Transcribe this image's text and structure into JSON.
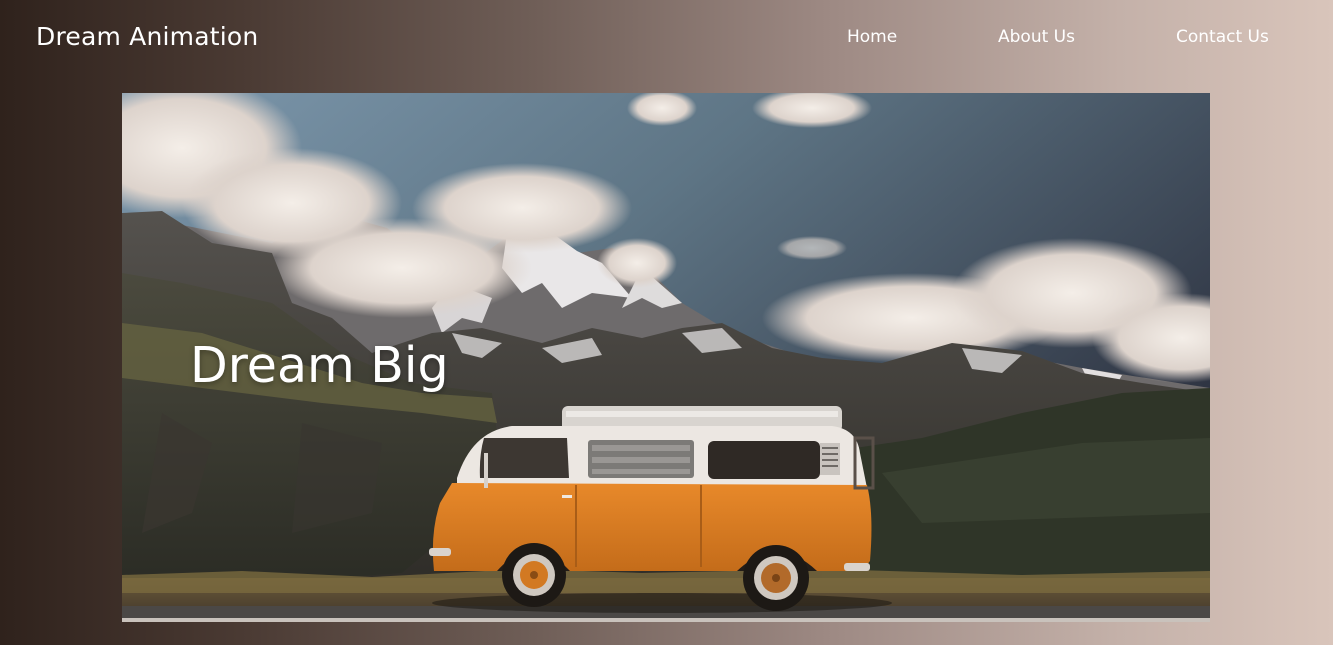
{
  "nav": {
    "brand": "Dream Animation",
    "links": [
      {
        "label": "Home"
      },
      {
        "label": "About Us"
      },
      {
        "label": "Contact Us"
      }
    ]
  },
  "hero": {
    "title": "Dream Big",
    "image_subject": "orange camper van parked below snowy mountains"
  },
  "colors": {
    "background_start": "#2f221c",
    "background_end": "#d9c5bb",
    "text": "#ffffff",
    "van_orange": "#d97d22"
  }
}
